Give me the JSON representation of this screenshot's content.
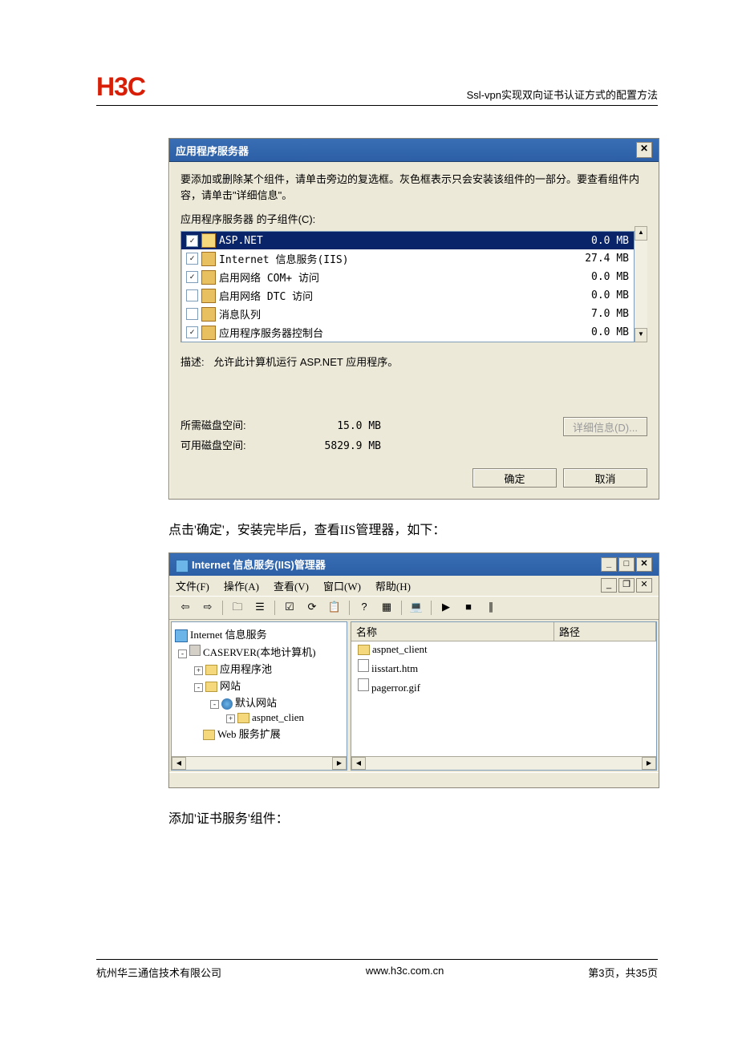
{
  "header": {
    "logo": "H3C",
    "doc_title": "Ssl-vpn实现双向证书认证方式的配置方法"
  },
  "dialog1": {
    "title": "应用程序服务器",
    "intro": "要添加或删除某个组件，请单击旁边的复选框。灰色框表示只会安装该组件的一部分。要查看组件内容，请单击\"详细信息\"。",
    "sub_label": "应用程序服务器 的子组件(C):",
    "items": [
      {
        "checked": true,
        "selected": true,
        "label": "ASP.NET",
        "size": "0.0 MB"
      },
      {
        "checked": true,
        "selected": false,
        "label": "Internet 信息服务(IIS)",
        "size": "27.4 MB"
      },
      {
        "checked": true,
        "selected": false,
        "label": "启用网络 COM+ 访问",
        "size": "0.0 MB"
      },
      {
        "checked": false,
        "selected": false,
        "label": "启用网络 DTC 访问",
        "size": "0.0 MB"
      },
      {
        "checked": false,
        "selected": false,
        "label": "消息队列",
        "size": "7.0 MB"
      },
      {
        "checked": true,
        "selected": false,
        "label": "应用程序服务器控制台",
        "size": "0.0 MB"
      }
    ],
    "desc_label": "描述:",
    "desc_text": "允许此计算机运行 ASP.NET 应用程序。",
    "disk_req_label": "所需磁盘空间:",
    "disk_req_val": "15.0 MB",
    "disk_free_label": "可用磁盘空间:",
    "disk_free_val": "5829.9 MB",
    "btn_details": "详细信息(D)...",
    "btn_ok": "确定",
    "btn_cancel": "取消"
  },
  "body_text1": "点击'确定'，安装完毕后，查看IIS管理器，如下：",
  "mmc": {
    "title": "Internet 信息服务(IIS)管理器",
    "menus": [
      "文件(F)",
      "操作(A)",
      "查看(V)",
      "窗口(W)",
      "帮助(H)"
    ],
    "tree_root": "Internet 信息服务",
    "tree": [
      "CASERVER(本地计算机)",
      "应用程序池",
      "网站",
      "默认网站",
      "aspnet_clien",
      "Web 服务扩展"
    ],
    "list_headers": [
      "名称",
      "路径"
    ],
    "list_items": [
      "aspnet_client",
      "iisstart.htm",
      "pagerror.gif"
    ]
  },
  "body_text2": "添加'证书服务'组件：",
  "footer": {
    "left": "杭州华三通信技术有限公司",
    "center": "www.h3c.com.cn",
    "right": "第3页，共35页"
  }
}
